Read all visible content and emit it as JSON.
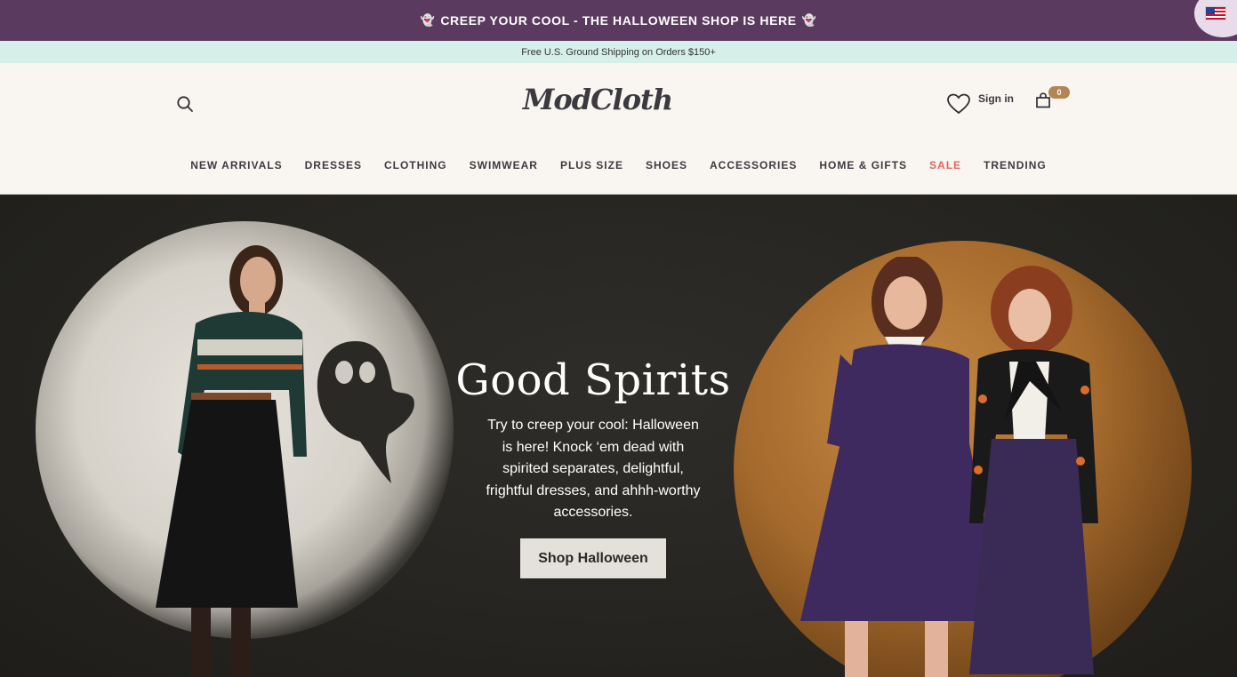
{
  "promo_bar": {
    "ghost_left": "👻",
    "text": "CREEP YOUR COOL - THE HALLOWEEN SHOP IS HERE",
    "ghost_right": "👻"
  },
  "shipping_bar": {
    "text": "Free U.S. Ground Shipping on Orders $150+"
  },
  "header": {
    "logo": "ModCloth",
    "sign_in": "Sign in",
    "cart_count": "0",
    "icons": {
      "search": "search-icon",
      "wishlist": "heart-icon",
      "cart": "bag-icon",
      "region": "us-flag-icon"
    }
  },
  "nav": {
    "items": [
      {
        "label": "NEW ARRIVALS"
      },
      {
        "label": "DRESSES"
      },
      {
        "label": "CLOTHING"
      },
      {
        "label": "SWIMWEAR"
      },
      {
        "label": "PLUS SIZE"
      },
      {
        "label": "SHOES"
      },
      {
        "label": "ACCESSORIES"
      },
      {
        "label": "HOME & GIFTS"
      },
      {
        "label": "SALE"
      },
      {
        "label": "TRENDING"
      }
    ]
  },
  "hero": {
    "title": "Good Spirits",
    "text": "Try to creep your cool: Halloween is here! Knock ‘em dead with spirited separates, delightful, frightful dresses, and ahhh-worthy accessories.",
    "cta": "Shop Halloween"
  },
  "colors": {
    "promo_bg": "#5b3a5f",
    "shipping_bg": "#d6efe9",
    "header_bg": "#f9f6f2",
    "sale": "#e0665c",
    "cart_badge": "#b38553"
  }
}
